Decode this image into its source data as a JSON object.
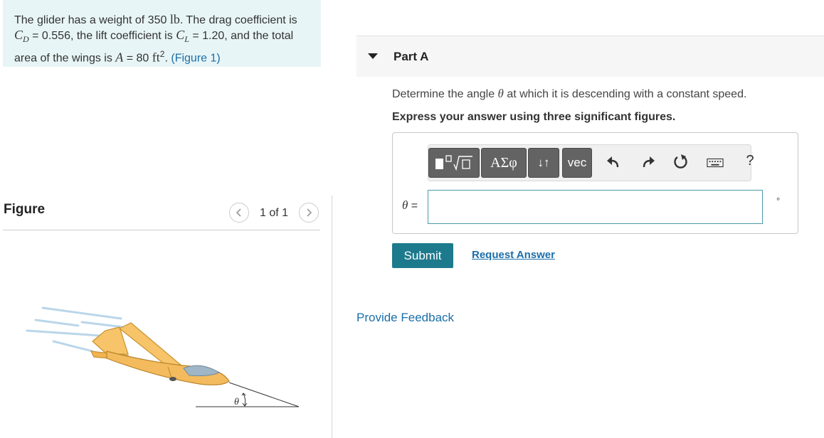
{
  "problem": {
    "t1": "The glider has a weight of 350 ",
    "weight_unit": "lb",
    "t2": ". The drag coefficient is",
    "cd_sym": "C",
    "cd_sub": "D",
    "t3": " = 0.556, the lift coefficient is ",
    "cl_sym": "C",
    "cl_sub": "L",
    "t4": " = 1.20, and the total area of the wings is ",
    "a_sym": "A",
    "t5": " = 80 ",
    "area_unit": "ft",
    "area_exp": "2",
    "t6": ". ",
    "figure_link": "(Figure 1)"
  },
  "figure": {
    "title": "Figure",
    "pager": "1 of 1",
    "angle_label": "θ"
  },
  "part": {
    "title": "Part A",
    "question_prefix": "Determine the angle ",
    "theta": "θ",
    "question_suffix": " at which it is descending with a constant speed.",
    "instruction": "Express your answer using three significant figures."
  },
  "toolbar": {
    "greek_label": "ΑΣφ",
    "arrows_label": "↓↑",
    "vec_label": "vec",
    "help_label": "?"
  },
  "answer": {
    "theta": "θ",
    "equals": " =",
    "value": "",
    "unit": "°"
  },
  "actions": {
    "submit": "Submit",
    "request_answer": "Request Answer",
    "feedback": "Provide Feedback"
  }
}
